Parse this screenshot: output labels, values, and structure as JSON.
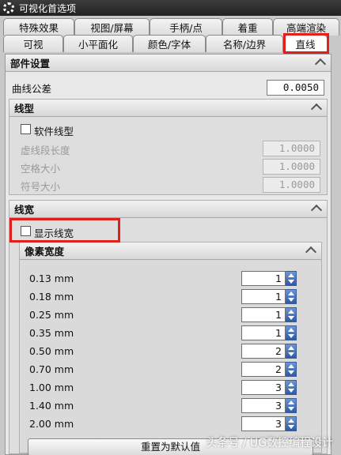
{
  "window": {
    "title": "可视化首选项"
  },
  "tabs": {
    "row1": [
      "特殊效果",
      "视图/屏幕",
      "手柄/点",
      "着重",
      "高端渲染"
    ],
    "row2": [
      "可视",
      "小平面化",
      "颜色/字体",
      "名称/边界",
      "直线"
    ],
    "active": "直线"
  },
  "parts_settings": {
    "header": "部件设置",
    "curve_tolerance_label": "曲线公差",
    "curve_tolerance_value": "0.0050"
  },
  "line_type": {
    "header": "线型",
    "software_linetype_label": "软件线型",
    "dash_length_label": "虚线段长度",
    "dash_length_value": "1.0000",
    "space_size_label": "空格大小",
    "space_size_value": "1.0000",
    "symbol_size_label": "符号大小",
    "symbol_size_value": "1.0000"
  },
  "line_width": {
    "header": "线宽",
    "show_width_label": "显示线宽",
    "pixel_width_header": "像素宽度",
    "rows": [
      {
        "label": "0.13 mm",
        "value": "1"
      },
      {
        "label": "0.18 mm",
        "value": "1"
      },
      {
        "label": "0.25 mm",
        "value": "1"
      },
      {
        "label": "0.35 mm",
        "value": "1"
      },
      {
        "label": "0.50 mm",
        "value": "2"
      },
      {
        "label": "0.70 mm",
        "value": "2"
      },
      {
        "label": "1.00 mm",
        "value": "3"
      },
      {
        "label": "1.40 mm",
        "value": "3"
      },
      {
        "label": "2.00 mm",
        "value": "3"
      }
    ],
    "reset_button": "重置为默认值"
  },
  "watermark": "头条号 / UG数控编程设计",
  "colors": {
    "highlight": "#e0201c",
    "spinner": "#2c5aa8"
  }
}
